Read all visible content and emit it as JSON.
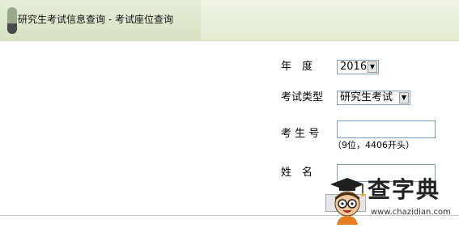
{
  "header": {
    "title": "研究生考试信息查询 - 考试座位查询"
  },
  "form": {
    "year_label": "年　度",
    "year_value": "2016",
    "exam_type_label": "考试类型",
    "exam_type_value": "研究生考试",
    "exam_no_label": "考 生 号",
    "exam_no_value": "",
    "exam_no_hint": "（9位，4406开头）",
    "name_label": "姓　名",
    "name_value": ""
  },
  "watermark": {
    "brand": "查字典",
    "url": "www.chazidian.com"
  },
  "colors": {
    "header_bg": "#e2ebd2",
    "input_border": "#7f9db9"
  }
}
